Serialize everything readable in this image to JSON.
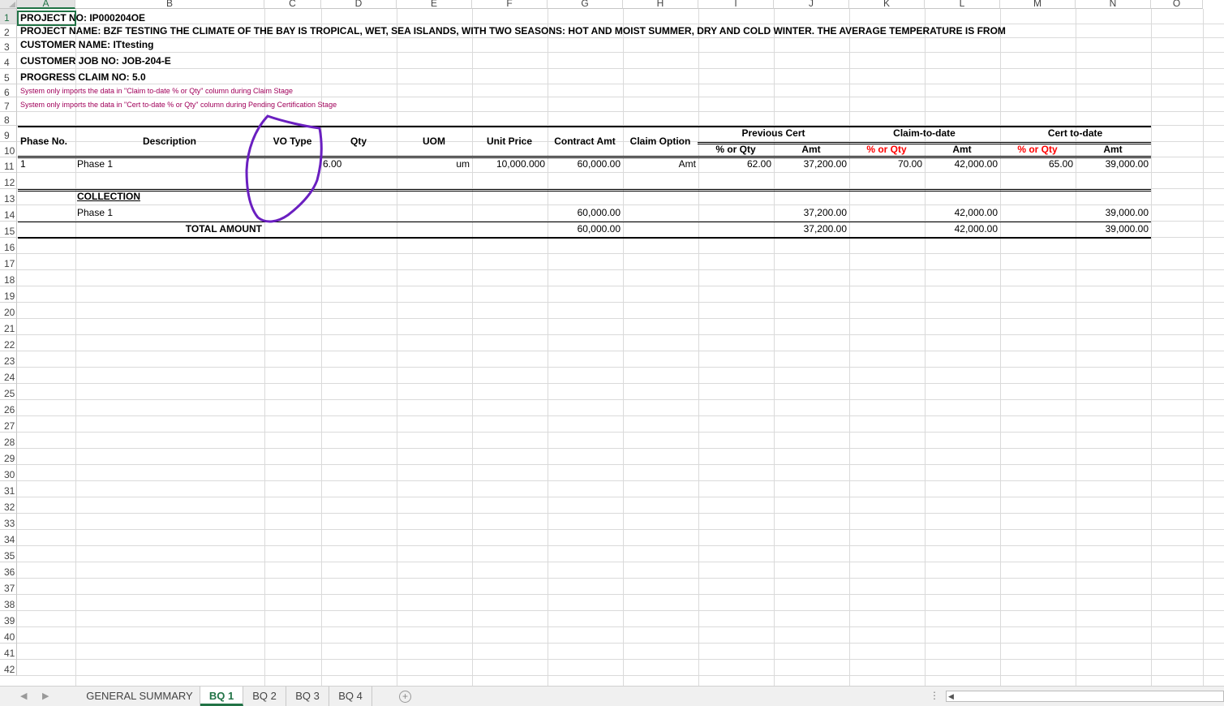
{
  "columns": [
    "A",
    "B",
    "C",
    "D",
    "E",
    "F",
    "G",
    "H",
    "I",
    "J",
    "K",
    "L",
    "M",
    "N",
    "O"
  ],
  "rows": [
    "1",
    "2",
    "3",
    "4",
    "5",
    "6",
    "7",
    "8",
    "9",
    "10",
    "11",
    "12",
    "13",
    "14",
    "15",
    "16",
    "17",
    "18",
    "19",
    "20",
    "21",
    "22",
    "23",
    "24",
    "25",
    "26",
    "27",
    "28",
    "29",
    "30",
    "31",
    "32",
    "33",
    "34",
    "35",
    "36",
    "37",
    "38",
    "39",
    "40",
    "41",
    "42"
  ],
  "header_info": {
    "project_no": "PROJECT NO: IP000204OE",
    "project_name": "PROJECT NAME: BZF TESTING THE CLIMATE OF THE BAY IS TROPICAL, WET, SEA ISLANDS, WITH TWO SEASONS: HOT AND MOIST SUMMER, DRY AND COLD WINTER. THE AVERAGE TEMPERATURE IS FROM",
    "customer_name": "CUSTOMER NAME: ITtesting",
    "customer_job_no": "CUSTOMER JOB NO: JOB-204-E",
    "progress_claim_no": "PROGRESS CLAIM NO: 5.0",
    "note_claim": "System only imports the data in \"Claim to-date % or Qty\" column during Claim Stage",
    "note_cert": "System only imports the data in \"Cert to-date % or Qty\" column during Pending Certification Stage"
  },
  "table_headers": {
    "phase_no": "Phase No.",
    "description": "Description",
    "vo_type": "VO Type",
    "qty": "Qty",
    "uom": "UOM",
    "unit_price": "Unit Price",
    "contract_amt": "Contract Amt",
    "claim_option": "Claim Option",
    "previous_cert": "Previous Cert",
    "claim_to_date": "Claim-to-date",
    "cert_to_date": "Cert to-date",
    "pct_or_qty": "% or Qty",
    "amt": "Amt"
  },
  "line_item": {
    "phase_no": "1",
    "description": "Phase 1",
    "vo_type": "",
    "qty": "6.00",
    "uom": "um",
    "unit_price": "10,000.000",
    "contract_amt": "60,000.00",
    "claim_option": "Amt",
    "prev_pct": "62.00",
    "prev_amt": "37,200.00",
    "claim_pct": "70.00",
    "claim_amt": "42,000.00",
    "cert_pct": "65.00",
    "cert_amt": "39,000.00"
  },
  "collection": {
    "title": "COLLECTION",
    "row_label": "Phase 1",
    "contract_amt": "60,000.00",
    "prev_amt": "37,200.00",
    "claim_amt": "42,000.00",
    "cert_amt": "39,000.00"
  },
  "total": {
    "label": "TOTAL AMOUNT",
    "contract_amt": "60,000.00",
    "prev_amt": "37,200.00",
    "claim_amt": "42,000.00",
    "cert_amt": "39,000.00"
  },
  "annotation": {
    "color": "#6a1fc0"
  },
  "sheet_tabs": [
    {
      "label": "GENERAL SUMMARY",
      "active": false
    },
    {
      "label": "BQ 1",
      "active": true
    },
    {
      "label": "BQ 2",
      "active": false
    },
    {
      "label": "BQ 3",
      "active": false
    },
    {
      "label": "BQ 4",
      "active": false
    }
  ],
  "colors": {
    "accent": "#217346",
    "note": "#a0005a",
    "red": "#ff0000"
  }
}
